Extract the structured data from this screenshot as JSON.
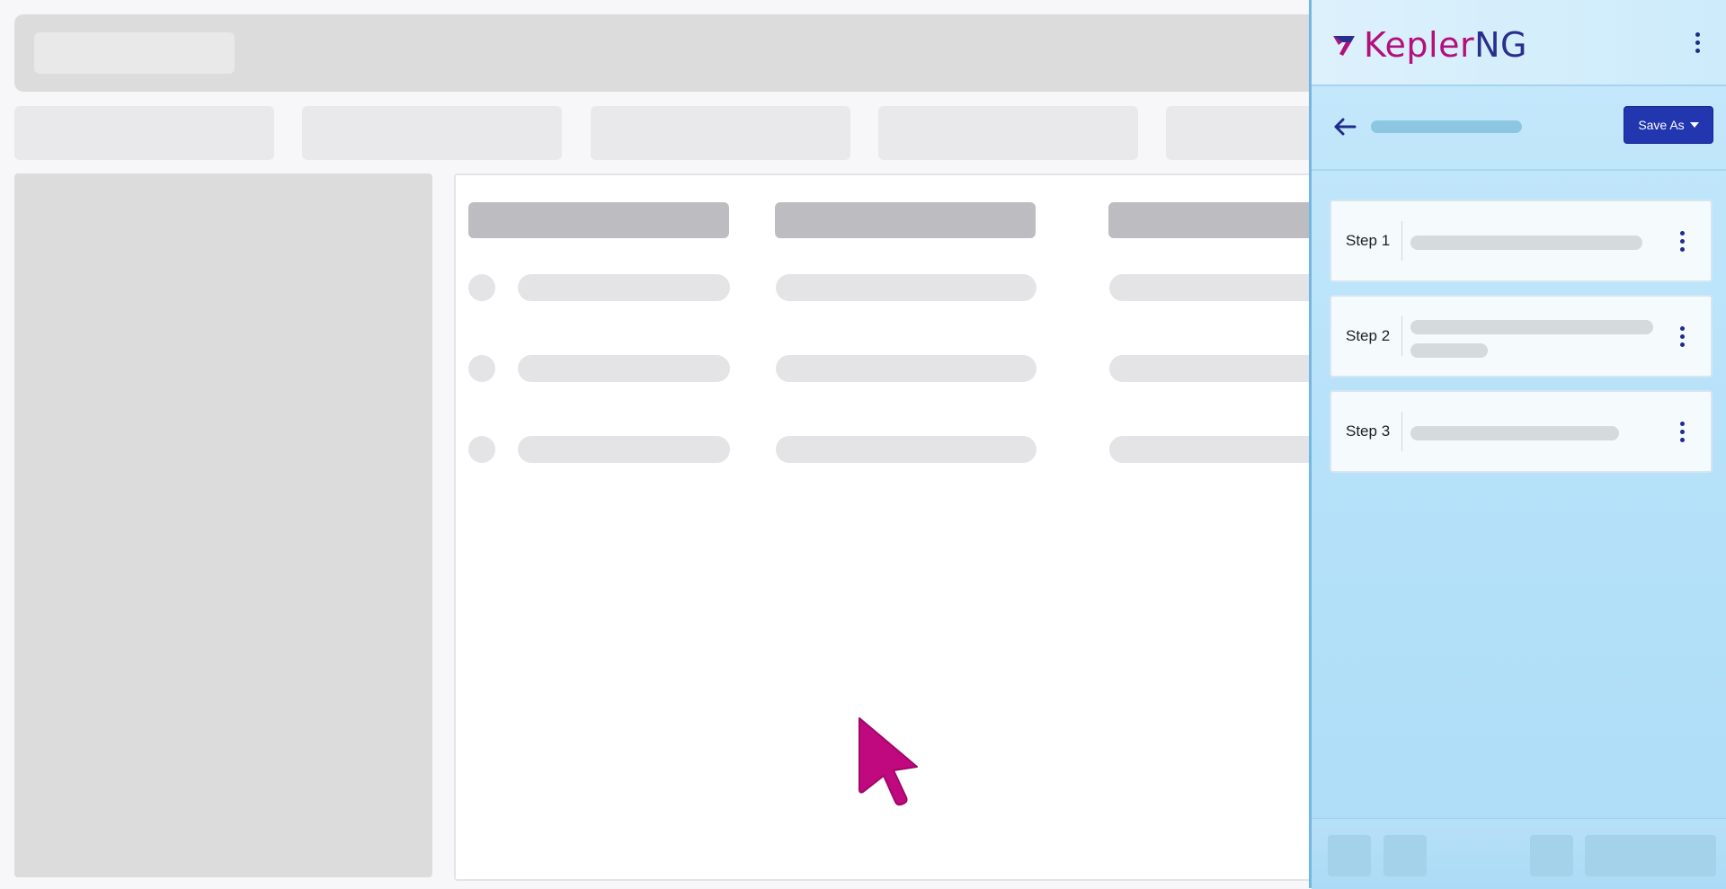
{
  "panel": {
    "brand": {
      "part1": "Kepler",
      "part2": "NG"
    },
    "header_menu_icon": "kebab-menu-icon",
    "toolbar": {
      "back_icon": "arrow-left-icon",
      "save_as_label": "Save As",
      "save_as_caret_icon": "caret-down-icon"
    },
    "steps": [
      {
        "label": "Step 1"
      },
      {
        "label": "Step 2"
      },
      {
        "label": "Step 3"
      }
    ]
  },
  "colors": {
    "brand_magenta": "#b30f7d",
    "brand_navy": "#2a2f8e",
    "primary_button": "#2236b0",
    "panel_bg": "#c6e8fb"
  }
}
